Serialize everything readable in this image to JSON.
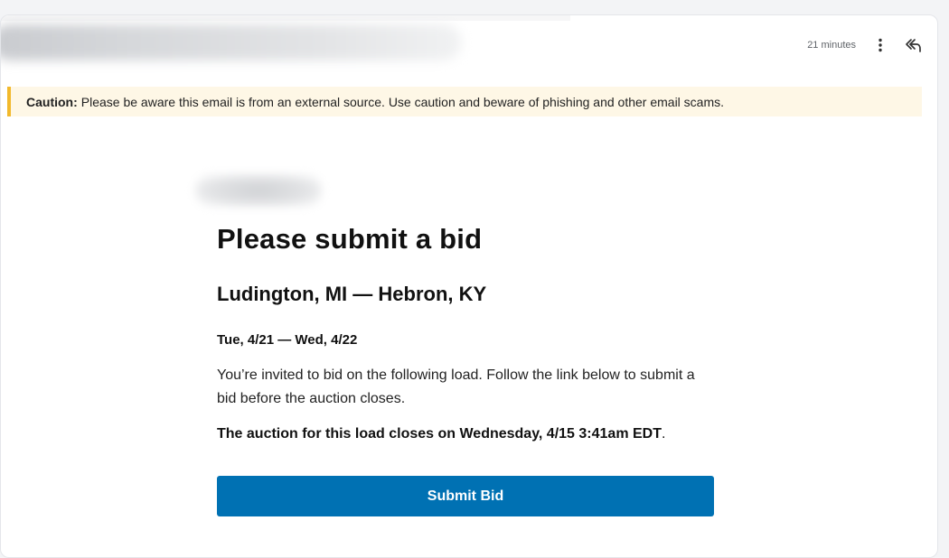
{
  "header": {
    "timestamp": "21 minutes",
    "more_icon": "more-vertical-icon",
    "reply_icon": "reply-all-icon"
  },
  "caution": {
    "label": "Caution:",
    "text": "Please be aware this email is from an external source. Use caution and beware of phishing and other email scams.",
    "accent_color": "#f2b92c",
    "background_color": "#fef7e6"
  },
  "email": {
    "title": "Please submit a bid",
    "route": "Ludington, MI — Hebron, KY",
    "dates": "Tue, 4/21 — Wed, 4/22",
    "invite_text": "You’re invited to bid on the following load. Follow the link below to submit a bid before the auction closes.",
    "closes_text": "The auction for this load closes on Wednesday, 4/15 3:41am EDT",
    "closes_suffix": ".",
    "button_label": "Submit Bid",
    "button_color": "#0071b3"
  }
}
